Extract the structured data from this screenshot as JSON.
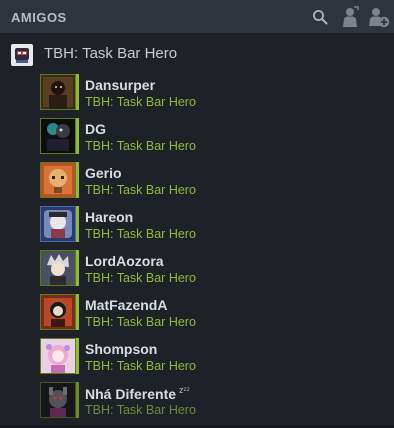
{
  "header": {
    "title": "AMIGOS"
  },
  "group": {
    "label": "TBH: Task Bar Hero"
  },
  "friends": [
    {
      "name": "Dansurper",
      "game": "TBH: Task Bar Hero",
      "status": "online"
    },
    {
      "name": "DG",
      "game": "TBH: Task Bar Hero",
      "status": "online"
    },
    {
      "name": "Gerio",
      "game": "TBH: Task Bar Hero",
      "status": "online"
    },
    {
      "name": "Hareon",
      "game": "TBH: Task Bar Hero",
      "status": "online"
    },
    {
      "name": "LordAozora",
      "game": "TBH: Task Bar Hero",
      "status": "online"
    },
    {
      "name": "MatFazendA",
      "game": "TBH: Task Bar Hero",
      "status": "online"
    },
    {
      "name": "Shompson",
      "game": "TBH: Task Bar Hero",
      "status": "online"
    },
    {
      "name": "Nhá Diferente",
      "game": "TBH: Task Bar Hero",
      "status": "away",
      "sleep_badge": "zᶻᶻ"
    }
  ],
  "colors": {
    "ingame_green": "#90ba3c",
    "header_bg": "#2f333c",
    "panel_bg": "#1e2127"
  },
  "icons": [
    "search-icon",
    "add-friend-icon",
    "add-user-icon"
  ]
}
